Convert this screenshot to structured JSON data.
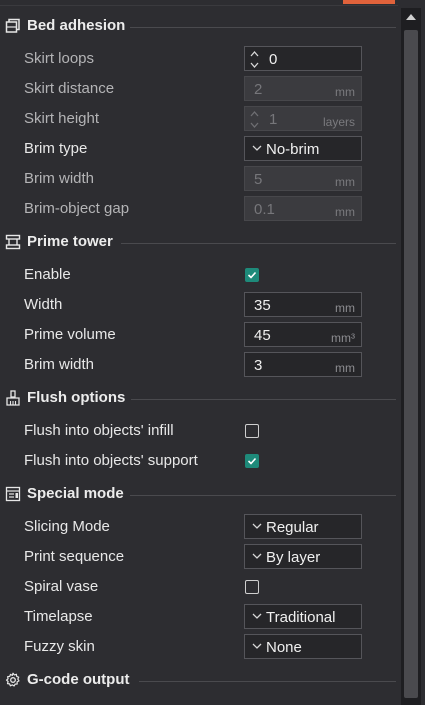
{
  "colors": {
    "background": "#2d2d31",
    "accent_tab": "#e0623b",
    "checkbox_checked": "#1e8a7a",
    "field_background": "#262629",
    "field_disabled_background": "#3b3b3f"
  },
  "sections": {
    "bed_adhesion": {
      "title": "Bed adhesion",
      "icon": "bed-adhesion-icon",
      "skirt_loops": {
        "label": "Skirt loops",
        "value": "0"
      },
      "skirt_distance": {
        "label": "Skirt distance",
        "value": "2",
        "unit": "mm"
      },
      "skirt_height": {
        "label": "Skirt height",
        "value": "1",
        "unit": "layers"
      },
      "brim_type": {
        "label": "Brim type",
        "value": "No-brim"
      },
      "brim_width": {
        "label": "Brim width",
        "value": "5",
        "unit": "mm"
      },
      "brim_object_gap": {
        "label": "Brim-object gap",
        "value": "0.1",
        "unit": "mm"
      }
    },
    "prime_tower": {
      "title": "Prime tower",
      "icon": "prime-tower-icon",
      "enable": {
        "label": "Enable",
        "checked": true
      },
      "width": {
        "label": "Width",
        "value": "35",
        "unit": "mm"
      },
      "prime_volume": {
        "label": "Prime volume",
        "value": "45",
        "unit": "mm³"
      },
      "brim_width": {
        "label": "Brim width",
        "value": "3",
        "unit": "mm"
      }
    },
    "flush_options": {
      "title": "Flush options",
      "icon": "flush-brush-icon",
      "flush_infill": {
        "label": "Flush into objects' infill",
        "checked": false
      },
      "flush_support": {
        "label": "Flush into objects' support",
        "checked": true
      }
    },
    "special_mode": {
      "title": "Special mode",
      "icon": "special-mode-icon",
      "slicing_mode": {
        "label": "Slicing Mode",
        "value": "Regular"
      },
      "print_sequence": {
        "label": "Print sequence",
        "value": "By layer"
      },
      "spiral_vase": {
        "label": "Spiral vase",
        "checked": false
      },
      "timelapse": {
        "label": "Timelapse",
        "value": "Traditional"
      },
      "fuzzy_skin": {
        "label": "Fuzzy skin",
        "value": "None"
      }
    },
    "gcode_output": {
      "title": "G-code output",
      "icon": "gear-icon"
    }
  }
}
